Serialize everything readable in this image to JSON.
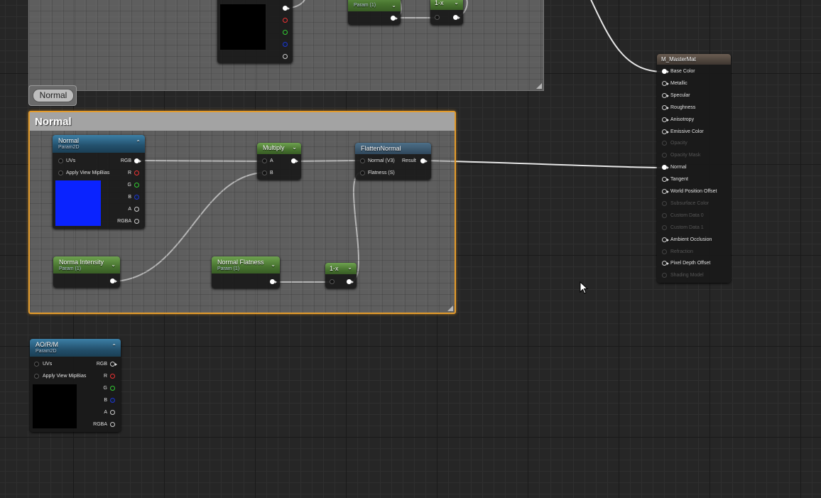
{
  "colors": {
    "background": "#262626",
    "comment_outline": "#e39b2c",
    "texture_normal": "#0a23ff",
    "texture_black": "#000000"
  },
  "comment_bubble": {
    "label": "Normal"
  },
  "comment_normal": {
    "title": "Normal"
  },
  "top_nodes": {
    "param_sub": "Param (1)",
    "one_minus": "1-x"
  },
  "normal_tex": {
    "title": "Normal",
    "subtitle": "Param2D",
    "inputs": [
      "UVs",
      "Apply View MipBias"
    ],
    "outputs": [
      "RGB",
      "R",
      "G",
      "B",
      "A",
      "RGBA"
    ]
  },
  "multiply": {
    "title": "Multiply",
    "inputs": [
      "A",
      "B"
    ]
  },
  "flatten": {
    "title": "FlattenNormal",
    "inputs": [
      "Normal (V3)",
      "Flatness (S)"
    ],
    "output": "Result"
  },
  "normal_intensity": {
    "title": "Norma Intensity",
    "subtitle": "Param (1)"
  },
  "normal_flatness": {
    "title": "Normal Flatness",
    "subtitle": "Param (1)"
  },
  "one_minus": {
    "title": "1-x"
  },
  "aorm_tex": {
    "title": "AO/R/M",
    "subtitle": "Param2D",
    "inputs": [
      "UVs",
      "Apply View MipBias"
    ],
    "outputs": [
      "RGB",
      "R",
      "G",
      "B",
      "A",
      "RGBA"
    ]
  },
  "master_mat": {
    "title": "M_MasterMat",
    "pins": [
      {
        "label": "Base Color",
        "enabled": true,
        "connected": true
      },
      {
        "label": "Metallic",
        "enabled": true,
        "connected": false
      },
      {
        "label": "Specular",
        "enabled": true,
        "connected": false
      },
      {
        "label": "Roughness",
        "enabled": true,
        "connected": false
      },
      {
        "label": "Anisotropy",
        "enabled": true,
        "connected": false
      },
      {
        "label": "Emissive Color",
        "enabled": true,
        "connected": false
      },
      {
        "label": "Opacity",
        "enabled": false,
        "connected": false
      },
      {
        "label": "Opacity Mask",
        "enabled": false,
        "connected": false
      },
      {
        "label": "Normal",
        "enabled": true,
        "connected": true
      },
      {
        "label": "Tangent",
        "enabled": true,
        "connected": false
      },
      {
        "label": "World Position Offset",
        "enabled": true,
        "connected": false
      },
      {
        "label": "Subsurface Color",
        "enabled": false,
        "connected": false
      },
      {
        "label": "Custom Data 0",
        "enabled": false,
        "connected": false
      },
      {
        "label": "Custom Data 1",
        "enabled": false,
        "connected": false
      },
      {
        "label": "Ambient Occlusion",
        "enabled": true,
        "connected": false
      },
      {
        "label": "Refraction",
        "enabled": false,
        "connected": false
      },
      {
        "label": "Pixel Depth Offset",
        "enabled": true,
        "connected": false
      },
      {
        "label": "Shading Model",
        "enabled": false,
        "connected": false
      }
    ]
  }
}
